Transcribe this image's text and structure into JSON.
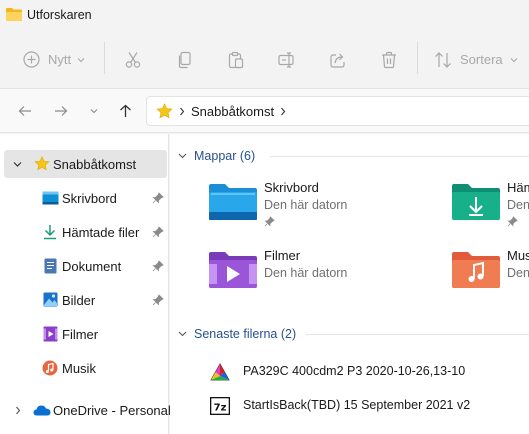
{
  "window": {
    "title": "Utforskaren"
  },
  "toolbar": {
    "new_label": "Nytt",
    "sort_label": "Sortera"
  },
  "address": {
    "crumb": "Snabbåtkomst"
  },
  "sidebar": {
    "items": [
      {
        "label": "Snabbåtkomst"
      },
      {
        "label": "Skrivbord"
      },
      {
        "label": "Hämtade filer"
      },
      {
        "label": "Dokument"
      },
      {
        "label": "Bilder"
      },
      {
        "label": "Filmer"
      },
      {
        "label": "Musik"
      },
      {
        "label": "OneDrive - Personal"
      }
    ]
  },
  "folders_group": {
    "header": "Mappar (6)",
    "items": [
      {
        "name": "Skrivbord",
        "location": "Den här datorn",
        "icon": "desktop-folder-icon"
      },
      {
        "name": "Hämtade filer",
        "location": "Den här datorn",
        "icon": "downloads-folder-icon"
      },
      {
        "name": "Filmer",
        "location": "Den här datorn",
        "icon": "videos-folder-icon"
      },
      {
        "name": "Musik",
        "location": "Den här datorn",
        "icon": "music-folder-icon"
      }
    ]
  },
  "recent_group": {
    "header": "Senaste filerna (2)",
    "items": [
      {
        "name": "PA329C 400cdm2 P3 2020-10-26,13-10",
        "icon": "color-profile-icon"
      },
      {
        "name": "StartIsBack(TBD) 15 September 2021 v2",
        "icon": "7z-archive-icon"
      }
    ]
  },
  "colors": {
    "accent": "#0067c0",
    "group_header": "#27508f",
    "disabled": "#a8a8a8"
  }
}
